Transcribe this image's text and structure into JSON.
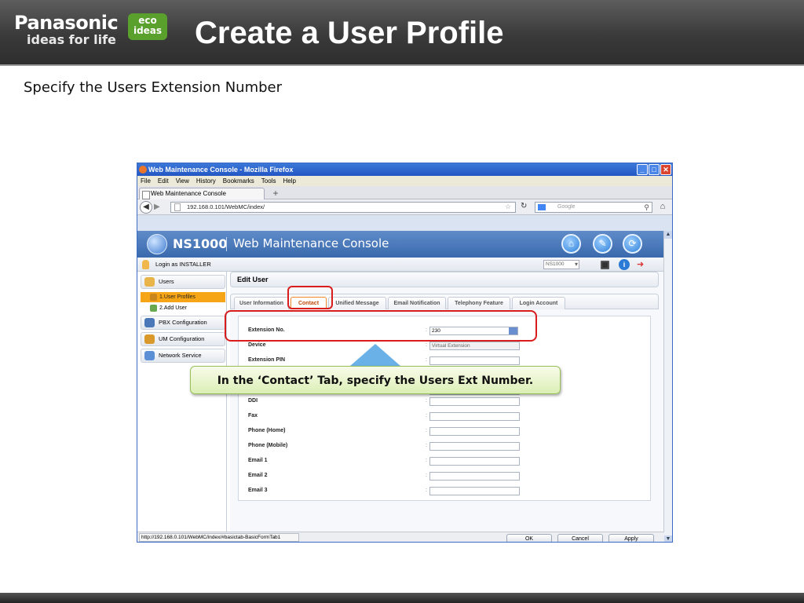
{
  "brand": {
    "name": "Panasonic",
    "tagline": "ideas for life",
    "eco_line1": "eco",
    "eco_line2": "ideas"
  },
  "slide": {
    "title": "Create a User Profile",
    "subtitle": "Specify the Users Extension Number"
  },
  "browser": {
    "window_title": "Web Maintenance Console - Mozilla Firefox",
    "menu": [
      "File",
      "Edit",
      "View",
      "History",
      "Bookmarks",
      "Tools",
      "Help"
    ],
    "tab_label": "Web Maintenance Console",
    "new_tab": "+",
    "url": "192.168.0.101/WebMC/index/",
    "search_placeholder": "Google",
    "status_url": "http://192.168.0.101/WebMC/index/#basictab-BasicFormTab1"
  },
  "app": {
    "product": "NS1000",
    "console_title": "Web Maintenance Console",
    "login_text": "Login as INSTALLER",
    "system_select": "NS1000",
    "page_heading": "Edit User"
  },
  "sidebar": {
    "users": "Users",
    "user_profiles": "1.User Profiles",
    "add_user": "2.Add User",
    "pbx_config": "PBX Configuration",
    "um_config": "UM Configuration",
    "network_service": "Network Service"
  },
  "tabs": [
    "User Information",
    "Contact",
    "Unified Message",
    "Email Notification",
    "Telephony Feature",
    "Login Account"
  ],
  "form": {
    "extension_label": "Extension No.",
    "extension_value": "230",
    "device_label": "Device",
    "device_value": "Virtual Extension",
    "ext_pin_label": "Extension PIN",
    "ddi_label": "DDI",
    "fax_label": "Fax",
    "phone_home_label": "Phone (Home)",
    "phone_mobile_label": "Phone (Mobile)",
    "email1_label": "Email 1",
    "email2_label": "Email 2",
    "email3_label": "Email 3",
    "colon": ":"
  },
  "buttons": {
    "ok": "OK",
    "cancel": "Cancel",
    "apply": "Apply"
  },
  "callout": "In the ‘Contact’ Tab, specify the Users Ext Number.",
  "colors": {
    "highlight": "#d91c1c",
    "title_bar": "#3a3a3a",
    "active_nav": "#f6a516",
    "callout_bg": "#dcefb5",
    "arrow": "#5aa9e6"
  }
}
